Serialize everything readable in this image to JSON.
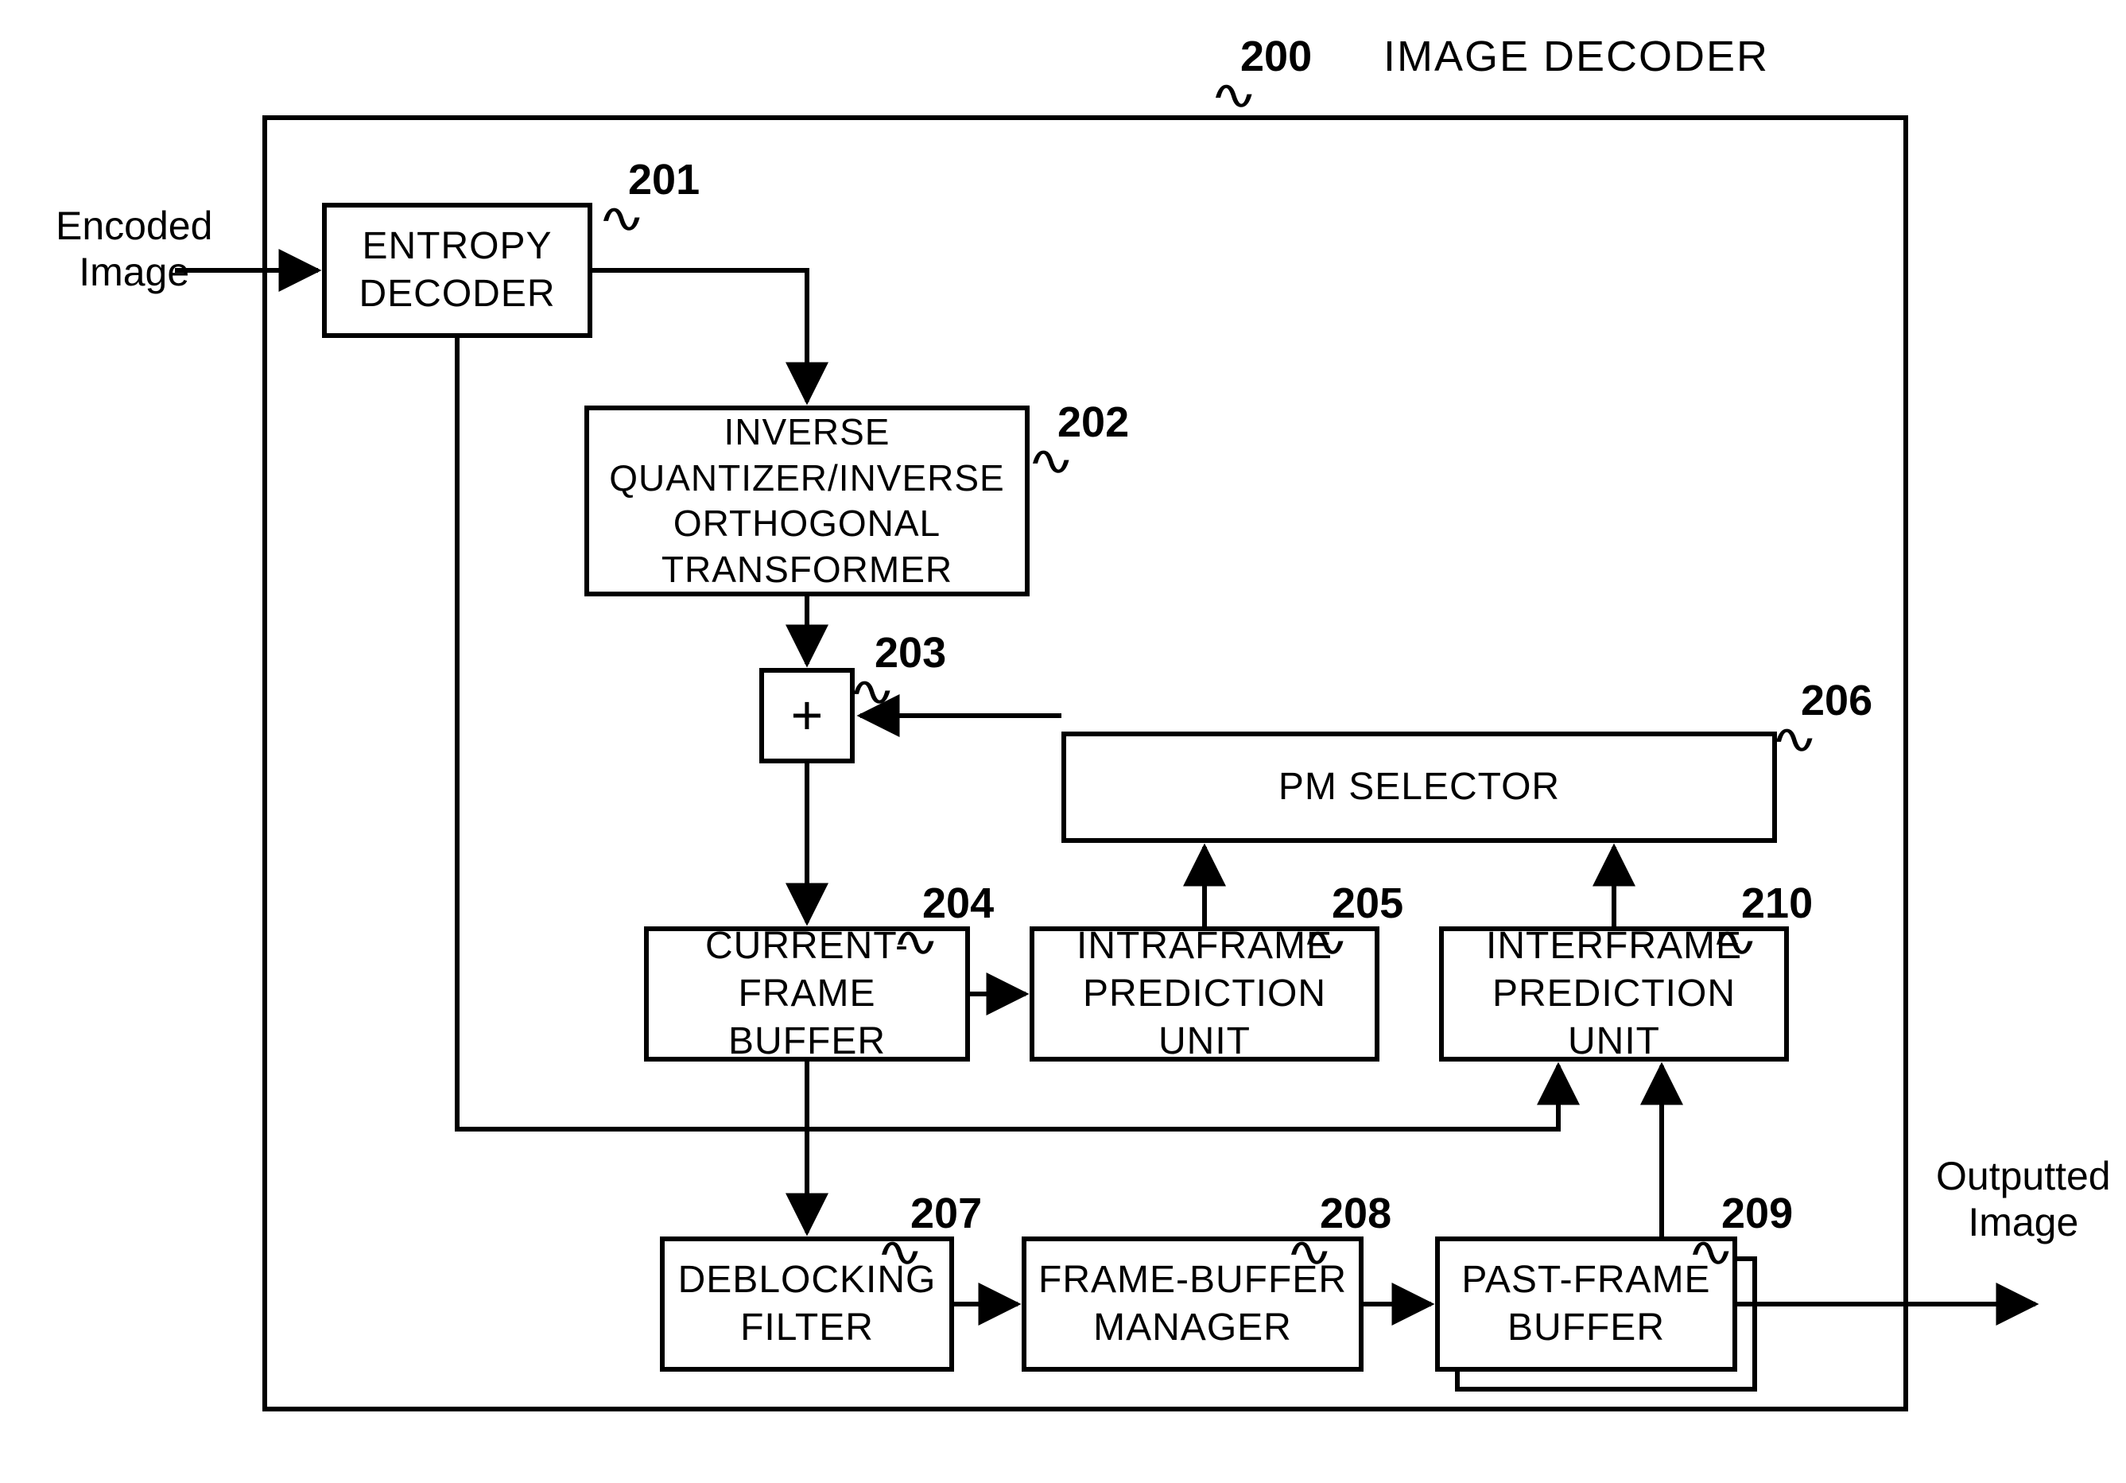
{
  "title": "IMAGE DECODER",
  "container_ref": "200",
  "io": {
    "input": "Encoded\nImage",
    "output": "Outputted\nImage"
  },
  "blocks": {
    "b201": {
      "ref": "201",
      "label": "ENTROPY\nDECODER"
    },
    "b202": {
      "ref": "202",
      "label": "INVERSE\nQUANTIZER/INVERSE\nORTHOGONAL\nTRANSFORMER"
    },
    "b203": {
      "ref": "203",
      "label": "+"
    },
    "b204": {
      "ref": "204",
      "label": "CURRENT-\nFRAME BUFFER"
    },
    "b205": {
      "ref": "205",
      "label": "INTRAFRAME\nPREDICTION UNIT"
    },
    "b206": {
      "ref": "206",
      "label": "PM SELECTOR"
    },
    "b207": {
      "ref": "207",
      "label": "DEBLOCKING\nFILTER"
    },
    "b208": {
      "ref": "208",
      "label": "FRAME-BUFFER\nMANAGER"
    },
    "b209": {
      "ref": "209",
      "label": "PAST-FRAME\nBUFFER"
    },
    "b210": {
      "ref": "210",
      "label": "INTERFRAME\nPREDICTION UNIT"
    }
  }
}
